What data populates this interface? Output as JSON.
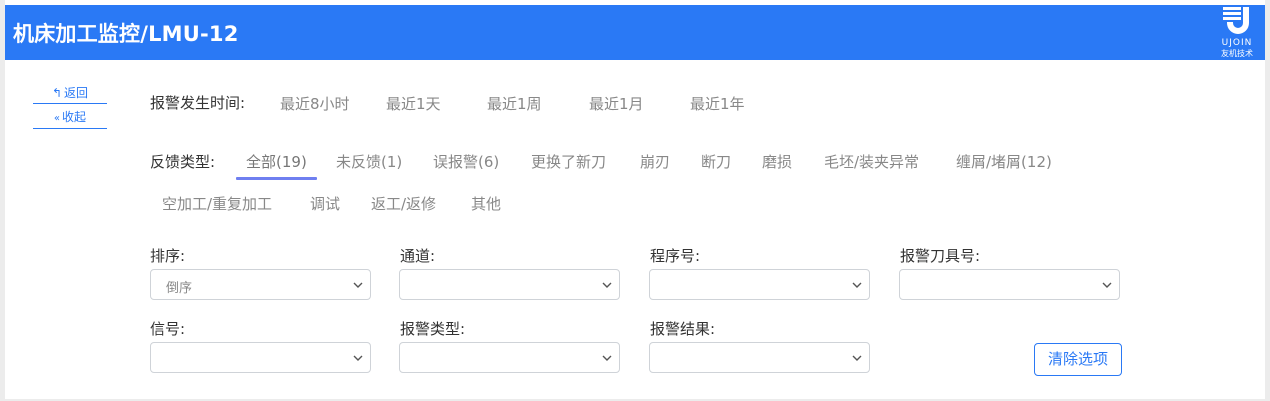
{
  "header": {
    "title": "机床加工监控/LMU-12"
  },
  "logo": {
    "brand": "UJOIN",
    "sub": "友机技术"
  },
  "side": {
    "back_label": "返回",
    "collapse_label": "收起"
  },
  "alarm_time": {
    "label": "报警发生时间:",
    "options": [
      "最近8小时",
      "最近1天",
      "最近1周",
      "最近1月",
      "最近1年"
    ]
  },
  "feedback": {
    "label": "反馈类型:",
    "tabs": [
      "全部(19)",
      "未反馈(1)",
      "误报警(6)",
      "更换了新刀",
      "崩刃",
      "断刀",
      "磨损",
      "毛坯/装夹异常",
      "缠屑/堵屑(12)",
      "空加工/重复加工",
      "调试",
      "返工/返修",
      "其他"
    ],
    "active_index": 0
  },
  "filters": {
    "sort": {
      "label": "排序:",
      "value": "倒序"
    },
    "channel": {
      "label": "通道:",
      "value": ""
    },
    "program": {
      "label": "程序号:",
      "value": ""
    },
    "tool": {
      "label": "报警刀具号:",
      "value": ""
    },
    "signal": {
      "label": "信号:",
      "value": ""
    },
    "alarm_type": {
      "label": "报警类型:",
      "value": ""
    },
    "alarm_result": {
      "label": "报警结果:",
      "value": ""
    }
  },
  "actions": {
    "clear_label": "清除选项"
  },
  "colors": {
    "accent": "#2a79f5",
    "tab_underline": "#6f7ff0"
  }
}
